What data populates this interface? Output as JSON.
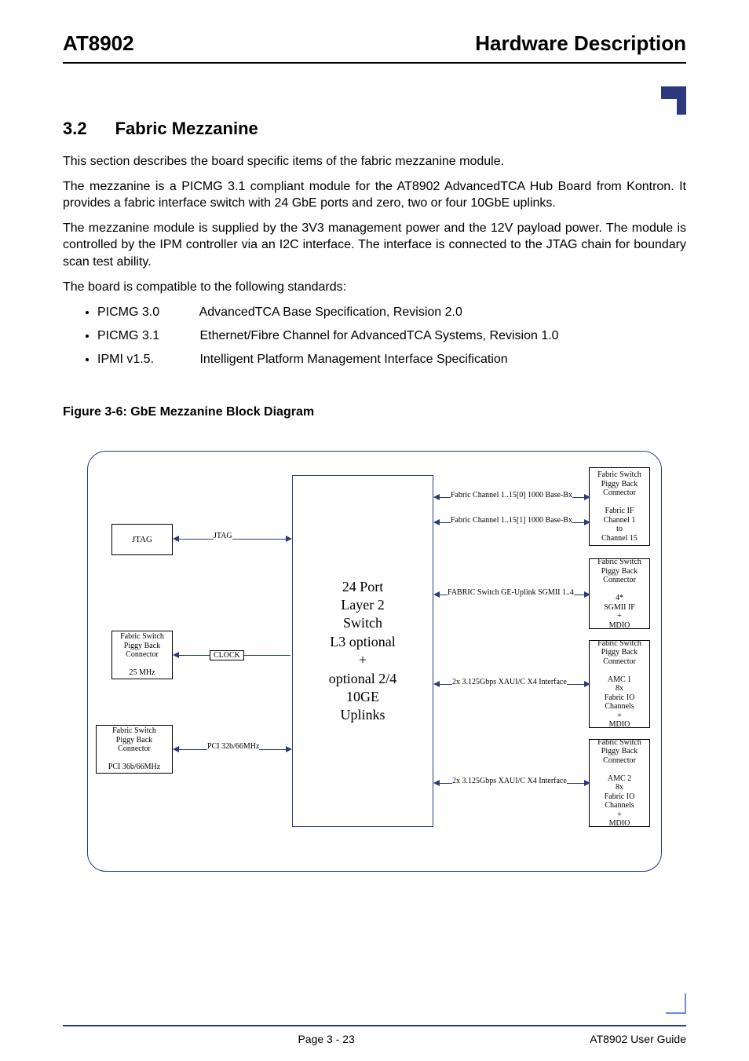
{
  "header": {
    "left": "AT8902",
    "right": "Hardware Description"
  },
  "section": {
    "number": "3.2",
    "title": "Fabric Mezzanine"
  },
  "paragraphs": {
    "p1": "This section describes the board specific items of the fabric mezzanine module.",
    "p2": "The mezzanine is a PICMG 3.1 compliant module for the AT8902 AdvancedTCA Hub Board from Kontron. It provides a fabric interface switch with 24 GbE ports and zero, two or four 10GbE  uplinks.",
    "p3": "The mezzanine module is supplied by the 3V3 management power and the 12V payload power. The module is controlled by the IPM controller via an I2C interface. The interface is connected to the JTAG chain for boundary scan test ability.",
    "p4": "The board is compatible to the following standards:"
  },
  "standards": [
    {
      "code": "PICMG 3.0",
      "desc": "AdvancedTCA Base Specification, Revision 2.0"
    },
    {
      "code": "PICMG 3.1",
      "desc": "Ethernet/Fibre Channel for AdvancedTCA Systems, Revision 1.0"
    },
    {
      "code": "IPMI v1.5.",
      "desc": "Intelligent Platform Management Interface Specification"
    }
  ],
  "figure": {
    "caption": "Figure 3-6:  GbE Mezzanine Block Diagram"
  },
  "diagram": {
    "boxes": {
      "jtag_left": "JTAG",
      "clock_left": "Fabric Switch\nPiggy Back\nConnector\n\n25 MHz",
      "pci_left": "Fabric Switch\nPiggy Back\nConnector\n\nPCI 36b/66MHz",
      "right_1": "Fabric Switch\nPiggy Back\nConnector\n\nFabric IF\nChannel 1\nto\nChannel 15",
      "right_2": "Fabric Switch\nPiggy Back\nConnector\n\n4*\nSGMII IF\n+\nMDIO",
      "right_3": "Fabric Switch\nPiggy Back\nConnector\n\nAMC 1\n8x\nFabric IO\nChannels\n+\nMDIO",
      "right_4": "Fabric Switch\nPiggy Back\nConnector\n\nAMC 2\n8x\nFabric IO\nChannels\n+\nMDIO",
      "center": "24 Port\nLayer 2\nSwitch\nL3 optional\n+\noptional 2/4\n10GE\nUplinks"
    },
    "labels": {
      "jtag": "JTAG",
      "clock": "CLOCK",
      "pci": "PCI 32b/66MHz",
      "fc0": "Fabric Channel 1..15[0] 1000 Base-Bx",
      "fc1": "Fabric Channel 1..15[1] 1000 Base-Bx",
      "sgmii": "FABRIC Switch GE-Uplink SGMII 1..4",
      "xaui1": "2x 3.125Gbps XAUI/C X4 Interface",
      "xaui2": "2x 3.125Gbps XAUI/C X4 Interface"
    }
  },
  "footer": {
    "page": "Page 3 - 23",
    "guide": "AT8902 User Guide"
  }
}
